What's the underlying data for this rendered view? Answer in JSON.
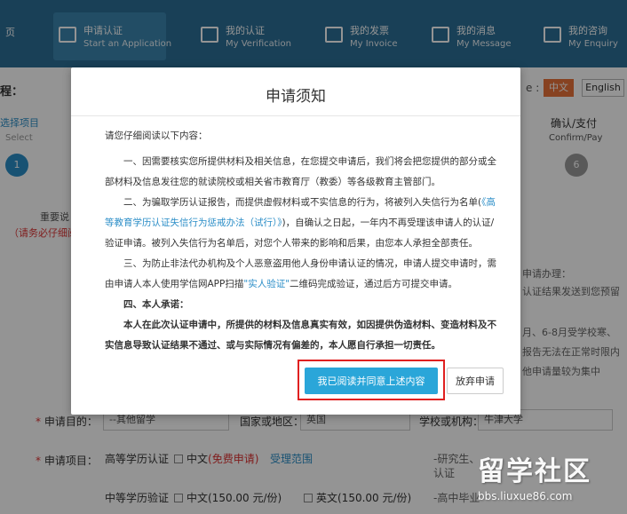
{
  "nav": [
    {
      "label": "页",
      "sub": "",
      "icon": "home-icon"
    },
    {
      "label": "申请认证",
      "sub": "Start an Application",
      "icon": "apply-icon"
    },
    {
      "label": "我的认证",
      "sub": "My Verification",
      "icon": "verification-icon"
    },
    {
      "label": "我的发票",
      "sub": "My Invoice",
      "icon": "invoice-icon"
    },
    {
      "label": "我的消息",
      "sub": "My Message",
      "icon": "message-icon"
    },
    {
      "label": "我的咨询",
      "sub": "My Enquiry",
      "icon": "enquiry-icon"
    }
  ],
  "lang": {
    "label": "e :",
    "zh": "中文",
    "en": "English"
  },
  "page": {
    "left_heading": "程：",
    "step1_label": "选择项目",
    "step1_sub": "Select",
    "step1_num": "1",
    "step6_label": "确认/支付",
    "step6_sub": "Confirm/Pay",
    "step6_num": "6",
    "note_a": "重要说",
    "note_b": "（请务必仔细阅",
    "right_notes": [
      "申请办理：",
      "认证结果发送到您预留",
      "月、6-8月受学校寒、",
      "报告无法在正常时限内",
      "他申请量较为集中"
    ]
  },
  "form": {
    "purpose_label": "申请目的：",
    "purpose_value": "--其他留学",
    "country_label": "国家或地区：",
    "country_value": "英国",
    "school_label": "学校或机构：",
    "school_value": "牛津大学",
    "items_label": "申请项目：",
    "higher_edu": "高等学历认证",
    "higher_cn": "中文",
    "higher_free": "(免费申请)",
    "scope_link": "受理范围",
    "grad_note": "-研究生、",
    "grad_note2": "认证",
    "secondary": "中等学历验证",
    "sec_cn": "中文(150.00 元/份)",
    "sec_en": "英文(150.00 元/份)",
    "sec_note": "-高中毕业"
  },
  "modal": {
    "title": "申请须知",
    "intro": "请您仔细阅读以下内容：",
    "p1": "一、因需要核实您所提供材料及相关信息，在您提交申请后，我们将会把您提供的部分或全部材料及信息发往您的就读院校或相关省市教育厅（教委）等各级教育主管部门。",
    "p2_pre": "二、为骗取学历认证报告，而提供虚假材料或不实信息的行为，将被列入失信行为名单(",
    "p2_link": "《高等教育学历认证失信行为惩戒办法（试行）》",
    "p2_post": ")，自确认之日起，一年内不再受理该申请人的认证/验证申请。被列入失信行为名单后，对您个人带来的影响和后果，由您本人承担全部责任。",
    "p3_pre": "三、为防止非法代办机构及个人恶意盗用他人身份申请认证的情况，申请人提交申请时，需由申请人本人使用学信网APP扫描",
    "p3_link": "\"实人验证\"",
    "p3_post": "二维码完成验证，通过后方可提交申请。",
    "p4_title": "四、本人承诺：",
    "p4_body": "本人在此次认证申请中，所提供的材料及信息真实有效，如因提供伪造材料、变造材料及不实信息导致认证结果不通过、或与实际情况有偏差的，本人愿自行承担一切责任。",
    "agree_button": "我已阅读并同意上述内容",
    "abandon_button": "放弃申请"
  },
  "watermark": {
    "big": "留学社区",
    "small": "bbs.liuxue86.com"
  },
  "colors": {
    "nav_bg": "#2c6f96",
    "primary_button": "#2aa6d9",
    "highlight": "#e02020",
    "accent": "#e8733a"
  }
}
